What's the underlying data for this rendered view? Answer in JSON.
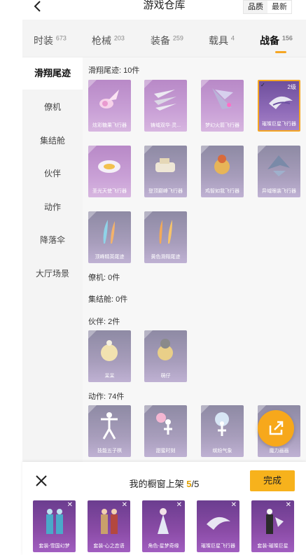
{
  "header": {
    "title": "游戏仓库",
    "back_icon": "chevron-left-icon",
    "sort_options": [
      "品质",
      "最新"
    ],
    "sort_selected": "品质"
  },
  "tabs": [
    {
      "label": "时装",
      "count": "673",
      "active": false
    },
    {
      "label": "枪械",
      "count": "203",
      "active": false
    },
    {
      "label": "装备",
      "count": "259",
      "active": false
    },
    {
      "label": "载具",
      "count": "4",
      "active": false
    },
    {
      "label": "战备",
      "count": "156",
      "active": true
    }
  ],
  "sidebar": {
    "items": [
      {
        "label": "滑翔尾迹",
        "active": true
      },
      {
        "label": "僚机",
        "active": false
      },
      {
        "label": "集结舱",
        "active": false
      },
      {
        "label": "伙伴",
        "active": false
      },
      {
        "label": "动作",
        "active": false
      },
      {
        "label": "降落伞",
        "active": false
      },
      {
        "label": "大厅场景",
        "active": false
      }
    ]
  },
  "sections": [
    {
      "title": "滑翔尾迹: 10件",
      "items": [
        {
          "label": "炫彩糖果飞行器",
          "rarity": "pink"
        },
        {
          "label": "铸域双华·灵...",
          "rarity": "pink"
        },
        {
          "label": "梦幻火箭飞行器",
          "rarity": "pink"
        },
        {
          "label": "璀璨巨星飞行器",
          "rarity": "purple",
          "selected": true,
          "level": "2级"
        },
        {
          "label": "圣光天使飞行器",
          "rarity": "pink"
        },
        {
          "label": "登顶巅峰飞行器",
          "rarity": "grey"
        },
        {
          "label": "鸡智如我飞行器",
          "rarity": "grey"
        },
        {
          "label": "异域眼装飞行器",
          "rarity": "grey"
        },
        {
          "label": "顶峰精英尾迹",
          "rarity": "grey"
        },
        {
          "label": "黄色滑翔尾迹",
          "rarity": "grey"
        }
      ]
    },
    {
      "title": "僚机: 0件",
      "items": []
    },
    {
      "title": "集结舱: 0件",
      "items": []
    },
    {
      "title": "伙伴: 2件",
      "items": [
        {
          "label": "呆呆",
          "rarity": "grey"
        },
        {
          "label": "萌仔",
          "rarity": "grey"
        }
      ]
    },
    {
      "title": "动作: 74件",
      "items": [
        {
          "label": "技能五子棋",
          "rarity": "grey"
        },
        {
          "label": "甜蜜时刻",
          "rarity": "grey"
        },
        {
          "label": "缤纷气象",
          "rarity": "grey"
        },
        {
          "label": "魔力画画",
          "rarity": "grey"
        }
      ]
    }
  ],
  "fab": {
    "icon": "share-export-icon"
  },
  "shelf": {
    "title_prefix": "我的橱窗上架",
    "count_current": "5",
    "count_total": "/5",
    "done_label": "完成",
    "close_icon": "close-icon",
    "items": [
      {
        "label": "套装-雪国幻梦"
      },
      {
        "label": "套装-心之恋语"
      },
      {
        "label": "角色-星梦奇缘"
      },
      {
        "label": "璀璨巨星飞行器"
      },
      {
        "label": "套装-璀璨巨星"
      }
    ]
  },
  "colors": {
    "accent": "#f5a623",
    "card_grey": "#9a93b0",
    "card_pink": "#c396d2",
    "shelf_purple": "#8b4ca7"
  }
}
